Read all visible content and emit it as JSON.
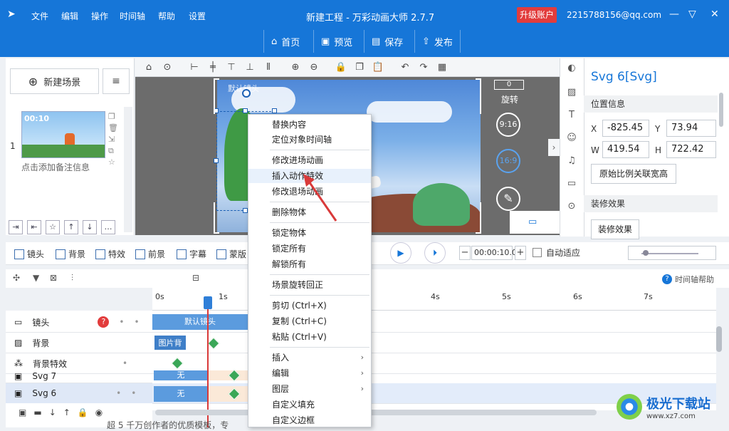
{
  "app": {
    "title": "新建工程 - 万彩动画大师 2.7.7",
    "upgrade_label": "升级账户",
    "email": "2215788156@qq.com"
  },
  "menu": [
    "文件",
    "编辑",
    "操作",
    "时间轴",
    "帮助",
    "设置"
  ],
  "topnav": [
    {
      "icon": "home-icon",
      "label": "首页"
    },
    {
      "icon": "preview-icon",
      "label": "预览"
    },
    {
      "icon": "save-icon",
      "label": "保存"
    },
    {
      "icon": "publish-icon",
      "label": "发布"
    }
  ],
  "scene_panel": {
    "new_scene_label": "新建场景",
    "scene_number": "1",
    "scene_time": "00:10",
    "note_placeholder": "点击添加备注信息"
  },
  "canvas": {
    "default_camera_label": "默认镜头",
    "rotate_label": "旋转",
    "rotate_value": "0",
    "ratio_916": "9:16",
    "ratio_169": "16:9"
  },
  "properties": {
    "title": "Svg 6[Svg]",
    "position_section": "位置信息",
    "x_label": "X",
    "x_value": "-825.45",
    "y_label": "Y",
    "y_value": "73.94",
    "w_label": "W",
    "w_value": "419.54",
    "h_label": "H",
    "h_value": "722.42",
    "lock_ratio_btn": "原始比例关联宽高",
    "decor_section": "装修效果",
    "decor_btn": "装修效果"
  },
  "timeline_toolbar": [
    {
      "icon": "camera-icon",
      "label": "镜头"
    },
    {
      "icon": "background-icon",
      "label": "背景"
    },
    {
      "icon": "effects-icon",
      "label": "特效"
    },
    {
      "icon": "foreground-icon",
      "label": "前景"
    },
    {
      "icon": "subtitle-icon",
      "label": "字幕"
    },
    {
      "icon": "mask-icon",
      "label": "蒙版"
    }
  ],
  "timeline": {
    "time_value": "00:00:10.0",
    "auto_fit_label": "自动适应",
    "help_label": "时间轴帮助",
    "ticks": [
      "0s",
      "1s",
      "4s",
      "5s",
      "6s",
      "7s"
    ],
    "tracks": [
      {
        "name": "镜头",
        "clip": "默认镜头"
      },
      {
        "name": "背景",
        "clip": "图片背"
      },
      {
        "name": "背景特效",
        "clip": ""
      },
      {
        "name": "Svg 7",
        "clip": "无"
      },
      {
        "name": "Svg 6",
        "clip": "无"
      }
    ]
  },
  "context_menu": [
    {
      "label": "替换内容"
    },
    {
      "label": "定位对象时间轴"
    },
    {
      "label": "修改进场动画"
    },
    {
      "label": "插入动作特效"
    },
    {
      "label": "修改退场动画"
    },
    {
      "label": "删除物体"
    },
    {
      "label": "锁定物体"
    },
    {
      "label": "锁定所有"
    },
    {
      "label": "解锁所有"
    },
    {
      "label": "场景旋转回正"
    },
    {
      "label": "剪切 (Ctrl+X)"
    },
    {
      "label": "复制 (Ctrl+C)"
    },
    {
      "label": "粘贴 (Ctrl+V)"
    },
    {
      "label": "插入"
    },
    {
      "label": "编辑"
    },
    {
      "label": "图层"
    },
    {
      "label": "自定义填充"
    },
    {
      "label": "自定义边框"
    }
  ],
  "watermark": {
    "name": "极光下载站",
    "url": "www.xz7.com"
  },
  "bottom_text": "超 5 千万创作者的优质模板，专",
  "colors": {
    "brand_blue": "#1676d8",
    "upgrade_red": "#e23c3c",
    "keyframe_green": "#3aa757",
    "playhead_red": "#d93a3a"
  }
}
